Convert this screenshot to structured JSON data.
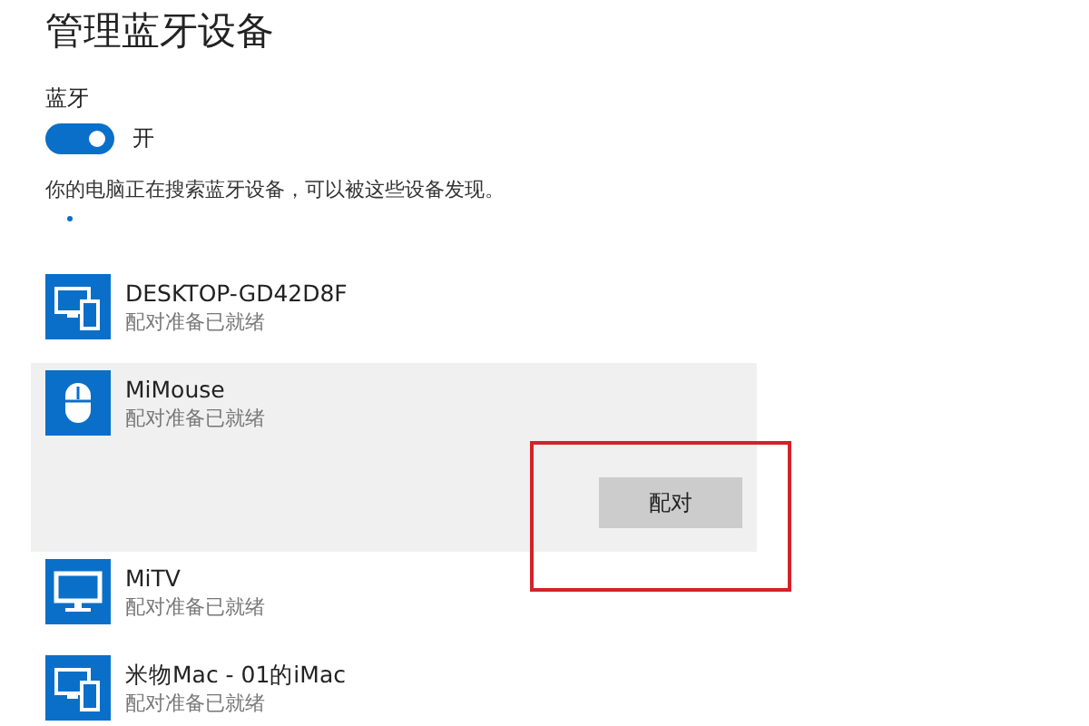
{
  "title": "管理蓝牙设备",
  "bluetooth": {
    "label": "蓝牙",
    "on": true,
    "state_text": "开"
  },
  "status": "你的电脑正在搜索蓝牙设备，可以被这些设备发现。",
  "devices": [
    {
      "kind": "pc",
      "name": "DESKTOP-GD42D8F",
      "status": "配对准备已就绪",
      "selected": false
    },
    {
      "kind": "mouse",
      "name": "MiMouse",
      "status": "配对准备已就绪",
      "selected": true,
      "action": "配对"
    },
    {
      "kind": "tv",
      "name": "MiTV",
      "status": "配对准备已就绪",
      "selected": false
    },
    {
      "kind": "pc",
      "name": "米物Mac - 01的iMac",
      "status": "配对准备已就绪",
      "selected": false
    }
  ]
}
